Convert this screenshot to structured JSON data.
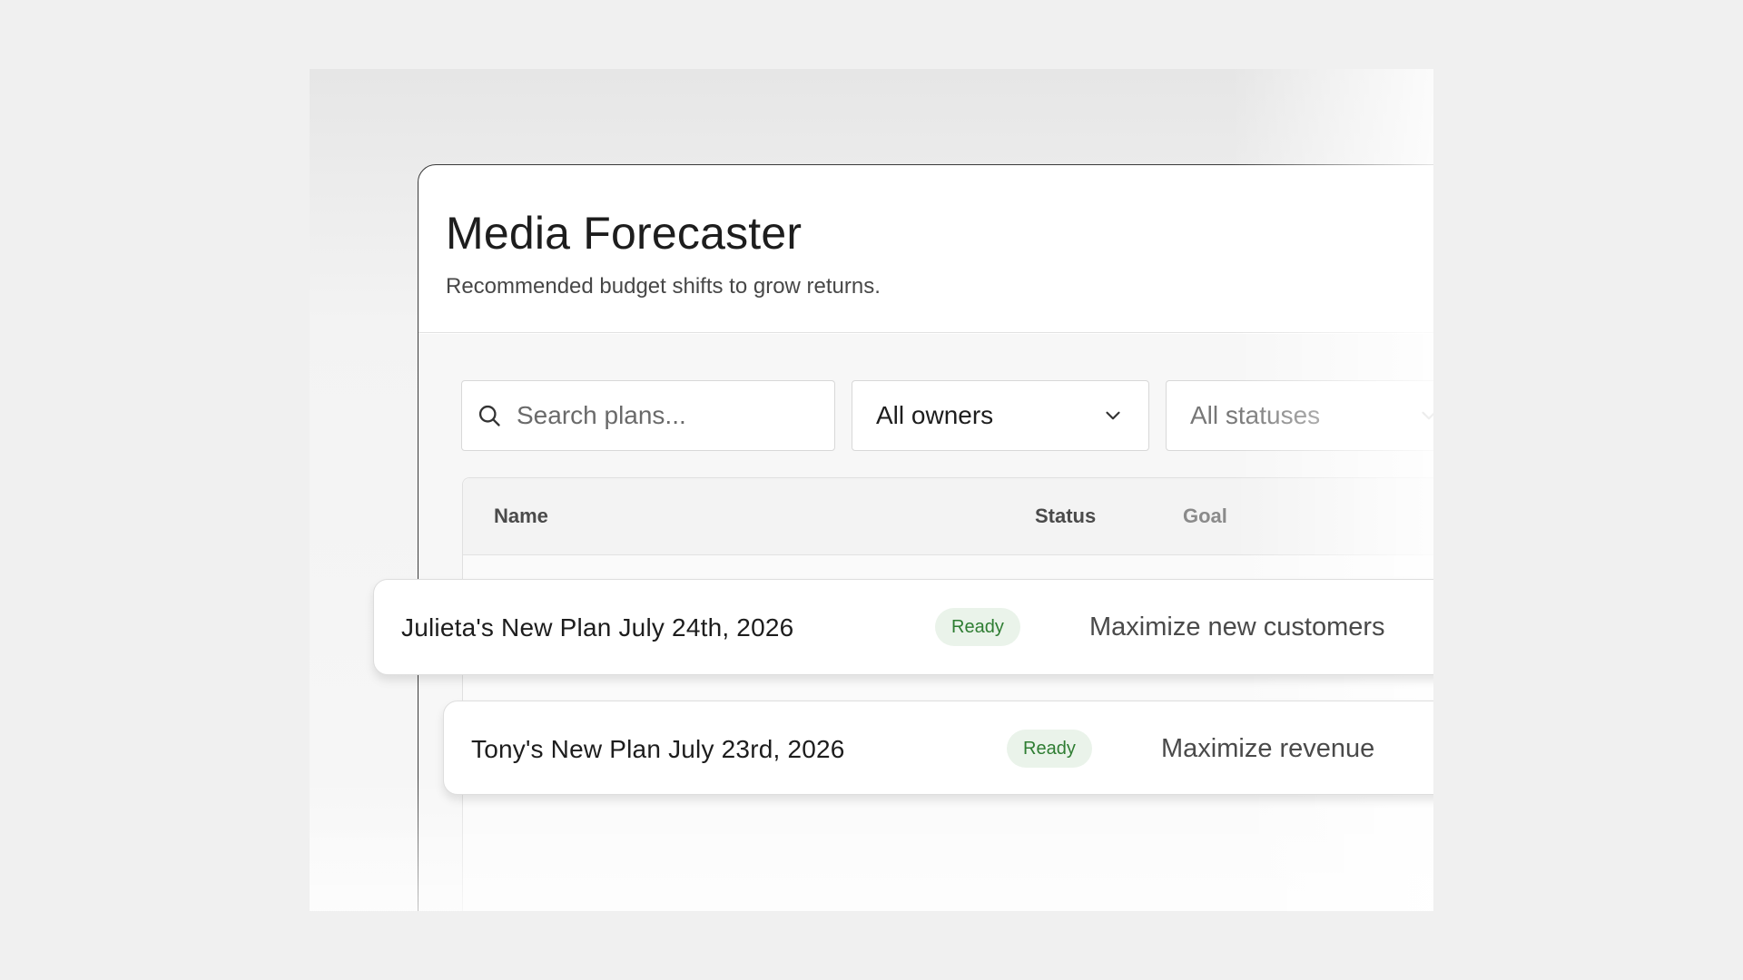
{
  "app": {
    "title": "Media Forecaster",
    "subtitle": "Recommended budget shifts to grow returns."
  },
  "filters": {
    "search_placeholder": "Search plans...",
    "owners_value": "All owners",
    "statuses_value": "All statuses"
  },
  "table": {
    "columns": [
      "Name",
      "Status",
      "Goal"
    ],
    "rows": [
      {
        "name": "Julieta's New Plan July 24th, 2026",
        "status": "Ready",
        "goal": "Maximize new customers"
      },
      {
        "name": "Tony's New Plan July 23rd, 2026",
        "status": "Ready",
        "goal": "Maximize revenue"
      }
    ]
  },
  "colors": {
    "status_ready_bg": "#eaf3ea",
    "status_ready_text": "#2e7d32"
  },
  "icons": [
    "search-icon",
    "chevron-down-icon"
  ]
}
